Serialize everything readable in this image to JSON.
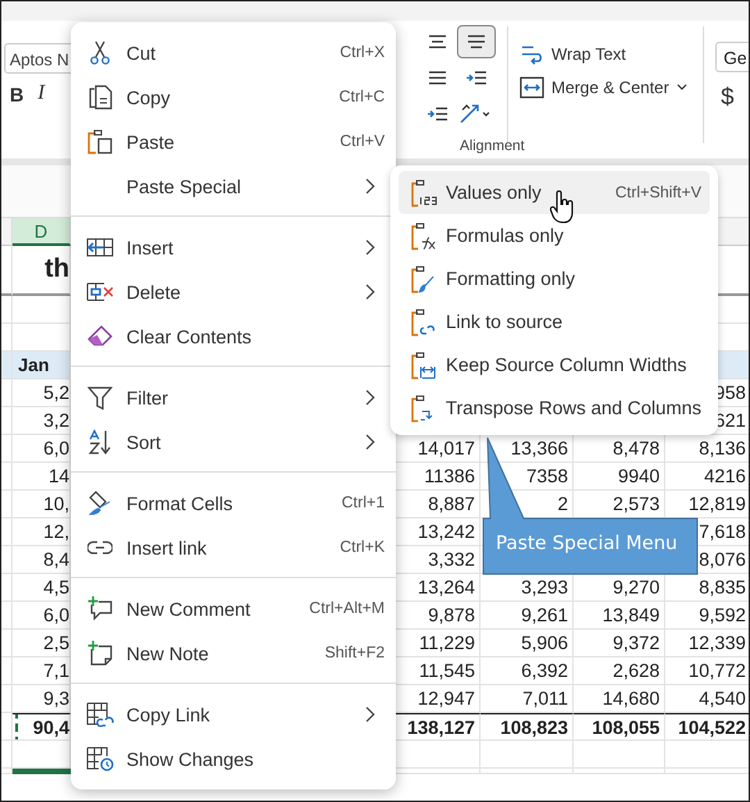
{
  "ribbon": {
    "font_field": "Aptos N",
    "bold": "B",
    "italic": "I",
    "align_buttons": [
      {
        "selected": false
      },
      {
        "selected": true
      },
      {
        "selected": false
      },
      {
        "selected": false
      },
      {
        "selected": false
      },
      {
        "selected": false
      }
    ],
    "wrap_text": "Wrap Text",
    "merge_center": "Merge & Center",
    "group_label": "Alignment",
    "number_format_field": "Ge",
    "currency": "$"
  },
  "sheet": {
    "column_header": "D",
    "title": "th",
    "header_row": {
      "col_1": "Jan"
    },
    "rows": [
      {
        "col_1": "5,2",
        "col_5": "958"
      },
      {
        "col_1": "3,2",
        "col_5": "621"
      },
      {
        "col_1": "6,0",
        "col_2": "14,017",
        "col_3": "13,366",
        "col_4": "8,478",
        "col_5": "8,136"
      },
      {
        "col_1": "14",
        "col_2": "11386",
        "col_3": "7358",
        "col_4": "9940",
        "col_5": "4216"
      },
      {
        "col_1": "10,",
        "col_2": "8,887",
        "col_3": "2",
        "col_4": "2,573",
        "col_5": "12,819"
      },
      {
        "col_1": "12,",
        "col_2": "13,242",
        "col_5": "7,618"
      },
      {
        "col_1": "8,4",
        "col_2": "3,332",
        "col_5": "8,076"
      },
      {
        "col_1": "4,5",
        "col_2": "13,264",
        "col_3": "3,293",
        "col_4": "9,270",
        "col_5": "8,835"
      },
      {
        "col_1": "6,0",
        "col_2": "9,878",
        "col_3": "9,261",
        "col_4": "13,849",
        "col_5": "9,592"
      },
      {
        "col_1": "2,5",
        "col_2": "11,229",
        "col_3": "5,906",
        "col_4": "9,372",
        "col_5": "12,339"
      },
      {
        "col_1": "7,1",
        "col_2": "11,545",
        "col_3": "6,392",
        "col_4": "2,628",
        "col_5": "10,772"
      },
      {
        "col_1": "9,3",
        "col_2": "12,947",
        "col_3": "7,011",
        "col_4": "14,680",
        "col_5": "4,540"
      }
    ],
    "total_row": {
      "col_1": "90,4",
      "col_2": "138,127",
      "col_3": "108,823",
      "col_4": "108,055",
      "col_5": "104,522"
    }
  },
  "context_menu": {
    "groups": [
      [
        {
          "label": "Cut",
          "shortcut": "Ctrl+X",
          "has_submenu": false
        },
        {
          "label": "Copy",
          "shortcut": "Ctrl+C",
          "has_submenu": false
        },
        {
          "label": "Paste",
          "shortcut": "Ctrl+V",
          "has_submenu": false
        },
        {
          "label": "Paste Special",
          "has_submenu": true
        }
      ],
      [
        {
          "label": "Insert",
          "has_submenu": true
        },
        {
          "label": "Delete",
          "has_submenu": true
        },
        {
          "label": "Clear Contents",
          "has_submenu": false
        }
      ],
      [
        {
          "label": "Filter",
          "has_submenu": true
        },
        {
          "label": "Sort",
          "has_submenu": true
        }
      ],
      [
        {
          "label": "Format Cells",
          "shortcut": "Ctrl+1",
          "has_submenu": false
        },
        {
          "label": "Insert link",
          "shortcut": "Ctrl+K",
          "has_submenu": false
        }
      ],
      [
        {
          "label": "New Comment",
          "shortcut": "Ctrl+Alt+M",
          "has_submenu": false
        },
        {
          "label": "New Note",
          "shortcut": "Shift+F2",
          "has_submenu": false
        }
      ],
      [
        {
          "label": "Copy Link",
          "has_submenu": true
        },
        {
          "label": "Show Changes",
          "has_submenu": false
        }
      ]
    ]
  },
  "paste_special_menu": {
    "items": [
      {
        "label": "Values only",
        "shortcut": "Ctrl+Shift+V",
        "selected": true
      },
      {
        "label": "Formulas only",
        "selected": false
      },
      {
        "label": "Formatting only",
        "selected": false
      },
      {
        "label": "Link to source",
        "selected": false
      },
      {
        "label": "Keep Source Column Widths",
        "selected": false
      },
      {
        "label": "Transpose Rows and Columns",
        "selected": false
      }
    ]
  },
  "callout": {
    "text": "Paste Special Menu"
  }
}
